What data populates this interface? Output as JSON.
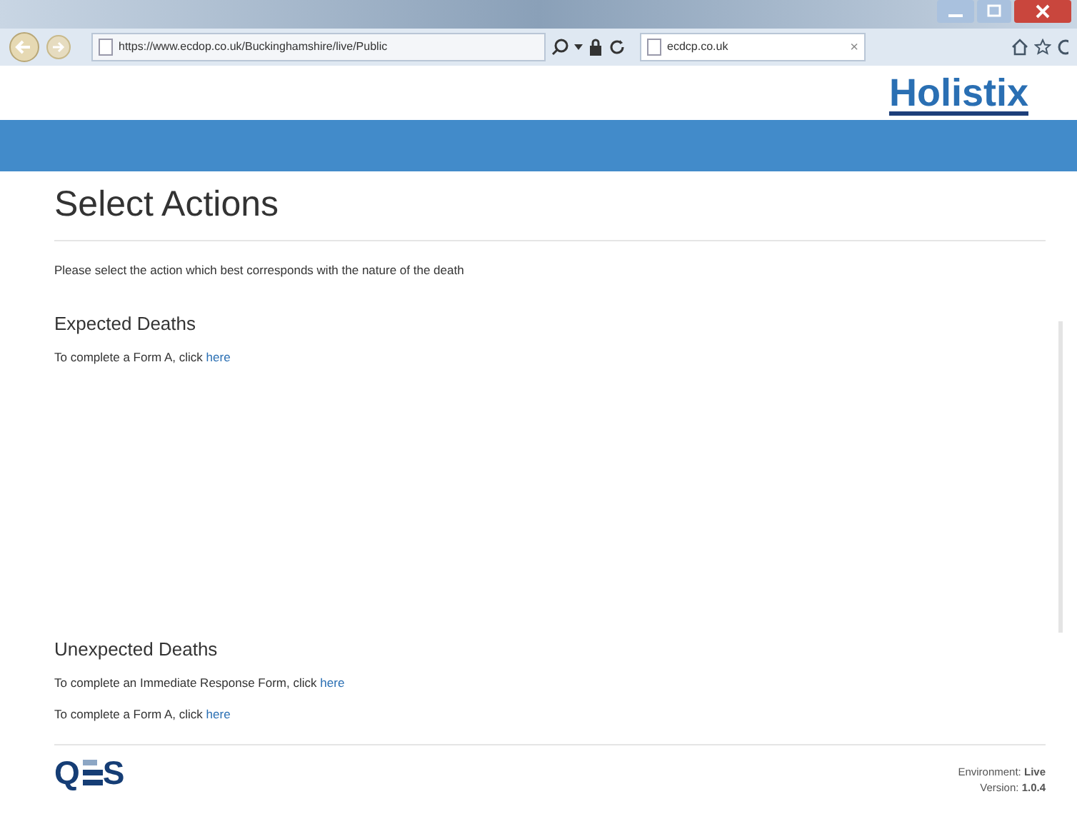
{
  "browser": {
    "address": "https://www.ecdop.co.uk/Buckinghamshire/live/Public",
    "tab": {
      "title": "ecdcp.co.uk",
      "close": "×"
    }
  },
  "header": {
    "logo": "Holistix"
  },
  "page": {
    "title": "Select Actions",
    "intro": "Please select the action which best corresponds with the nature of the death",
    "sections": [
      {
        "heading": "Expected Deaths",
        "actions": [
          {
            "text": "To complete a Form A, click",
            "link": "here"
          }
        ]
      },
      {
        "heading": "Unexpected Deaths",
        "actions": [
          {
            "text": "To complete an Immediate Response Form, click",
            "link": "here"
          },
          {
            "text": "To complete a Form A, click",
            "link": "here"
          }
        ]
      }
    ]
  },
  "footer": {
    "logo": {
      "first": "Q",
      "last": "S"
    },
    "environment": "Environment: **Live**",
    "version": "Version: **1.0.4**"
  }
}
